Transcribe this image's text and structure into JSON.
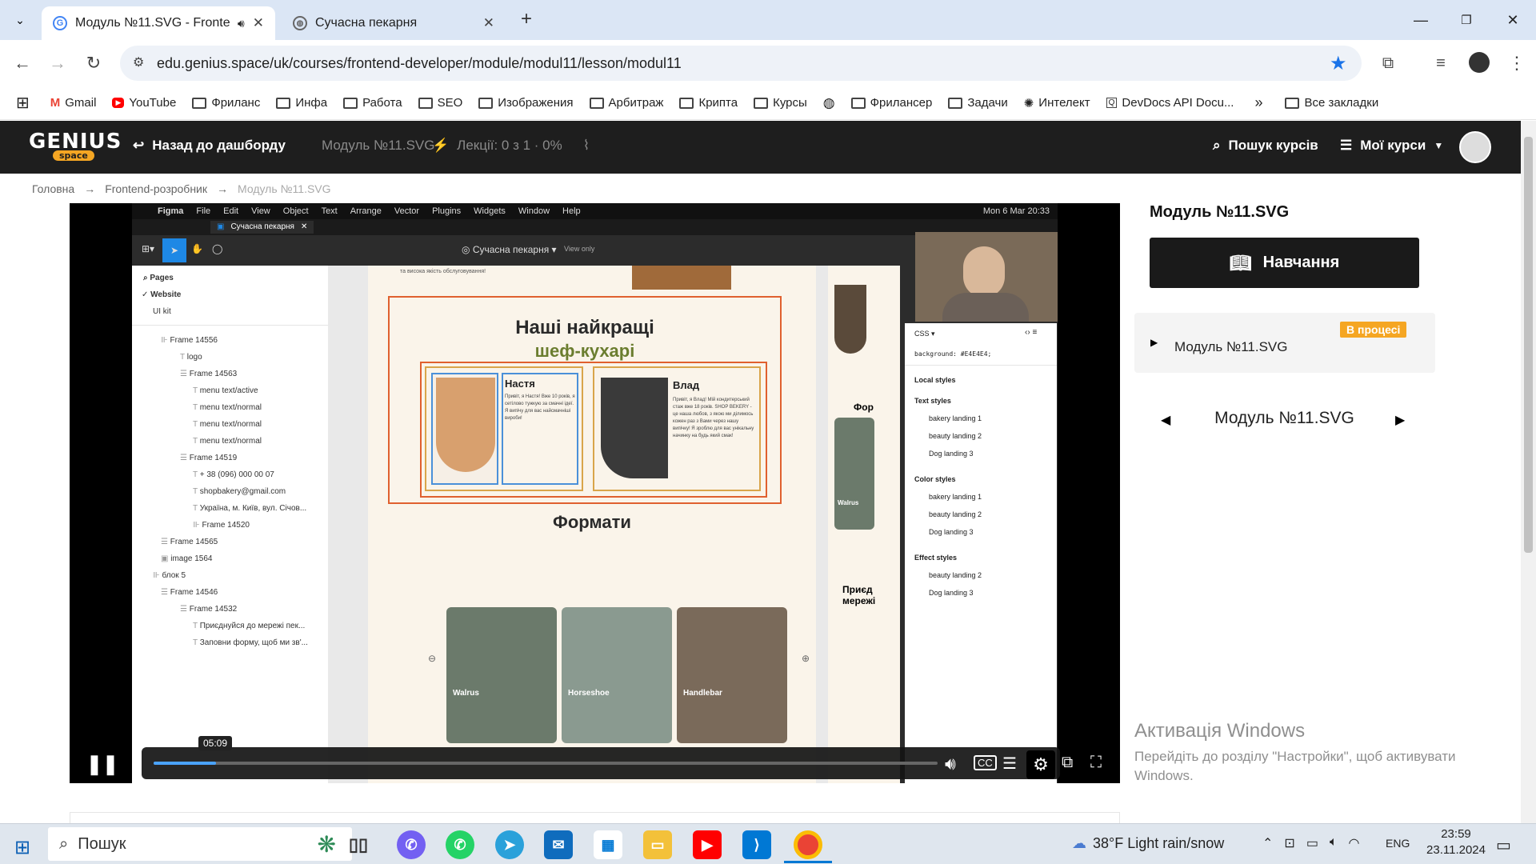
{
  "browser": {
    "tabs": [
      {
        "title": "Модуль №11.SVG - Fronten",
        "active": true
      },
      {
        "title": "Сучасна пекарня",
        "active": false
      }
    ],
    "url": "edu.genius.space/uk/courses/frontend-developer/module/modul11/lesson/modul11",
    "bookmarks": [
      "Gmail",
      "YouTube",
      "Фриланс",
      "Инфа",
      "Работа",
      "SEO",
      "Изображения",
      "Арбитраж",
      "Крипта",
      "Курсы",
      "Фрилансер",
      "Задачи",
      "Интелект",
      "DevDocs API Docu..."
    ],
    "all_bookmarks": "Все закладки"
  },
  "site": {
    "logo_text": "GENIUS",
    "logo_sub": "space",
    "back": "Назад до дашборду",
    "module": "Модуль №11.SVG",
    "lectures": "Лекції: 0 з 1 · 0%",
    "search": "Пошук курсів",
    "my_courses": "Мої курси"
  },
  "breadcrumbs": [
    "Головна",
    "Frontend-розробник",
    "Модуль №11.SVG"
  ],
  "video": {
    "mac_menu": [
      "Figma",
      "File",
      "Edit",
      "View",
      "Object",
      "Text",
      "Arrange",
      "Vector",
      "Plugins",
      "Widgets",
      "Window",
      "Help"
    ],
    "mac_clock": "Mon 6 Mar  20:33",
    "figma_tab": "Сучасна пекарня",
    "file_name": "Сучасна пекарня",
    "view_only": "View only",
    "pages_label": "Pages",
    "pages": [
      "Website",
      "UI kit"
    ],
    "layers": [
      "Frame 14556",
      "logo",
      "Frame 14563",
      "menu text/active",
      "menu text/normal",
      "menu text/normal",
      "menu text/normal",
      "Frame 14519",
      "+ 38 (096) 000 00 07",
      "shopbakery@gmail.com",
      "Україна, м. Київ, вул. Січов...",
      "Frame 14520",
      "Frame 14565",
      "image 1564",
      "блок 5",
      "Frame 14546",
      "Frame 14532",
      "Приєднуйся до мережі пек...",
      "Заповни форму, щоб ми зв'..."
    ],
    "page_intro": "та висока якість обслуговування!",
    "section_title_1": "Наші найкращі",
    "section_title_2": "шеф-кухарі",
    "chef1_name": "Настя",
    "chef1_text": "Привіт, я Настя! Вже 10 років, я сетілово тужкую за смачні ідеї. Я випічу для вас найсмачніші вироби!",
    "chef2_name": "Влад",
    "chef2_text": "Привіт, я Влад! Мій кондитерський стаж вже 18 років. SHOP BEKERY - це наша любов, з якою ми ділимось кожен раз з Вами через нашу випічку! Я зроблю для вас унікальну начинку на будь який смак!",
    "formats_title": "Формати",
    "formats": [
      "Walrus",
      "Horseshoe",
      "Handlebar"
    ],
    "side_label_1": "Фор",
    "side_label_2": "Walrus",
    "side_label_3": "Приєд мережі",
    "css_label": "CSS",
    "css_code": "background: #E4E4E4;",
    "local_styles": "Local styles",
    "text_styles": "Text styles",
    "text_style_items": [
      "bakery landing 1",
      "beauty landing 2",
      "Dog landing 3"
    ],
    "color_styles": "Color styles",
    "color_style_items": [
      "bakery landing 1",
      "beauty landing 2",
      "Dog landing 3"
    ],
    "effect_styles": "Effect styles",
    "effect_style_items": [
      "beauty landing 2",
      "Dog landing 3"
    ],
    "time_tooltip": "05:09",
    "progress": 0.08
  },
  "sidebar": {
    "lesson_title": "Модуль №11.SVG",
    "learn_button": "Навчання",
    "module_item": "Модуль №11.SVG",
    "badge": "В процесі",
    "nav_title": "Модуль №11.SVG"
  },
  "windows_activation": {
    "title": "Активація Windows",
    "line1": "Перейдіть до розділу \"Настройки\", щоб активувати",
    "line2": "Windows."
  },
  "taskbar": {
    "search": "Пошук",
    "weather": "38°F  Light rain/snow",
    "lang": "ENG",
    "time": "23:59",
    "date": "23.11.2024"
  },
  "colors": {
    "accent": "#f5a623",
    "header": "#1e1e1e",
    "figma_blue": "#1e88e5",
    "chef_frame": "#e0602f"
  }
}
